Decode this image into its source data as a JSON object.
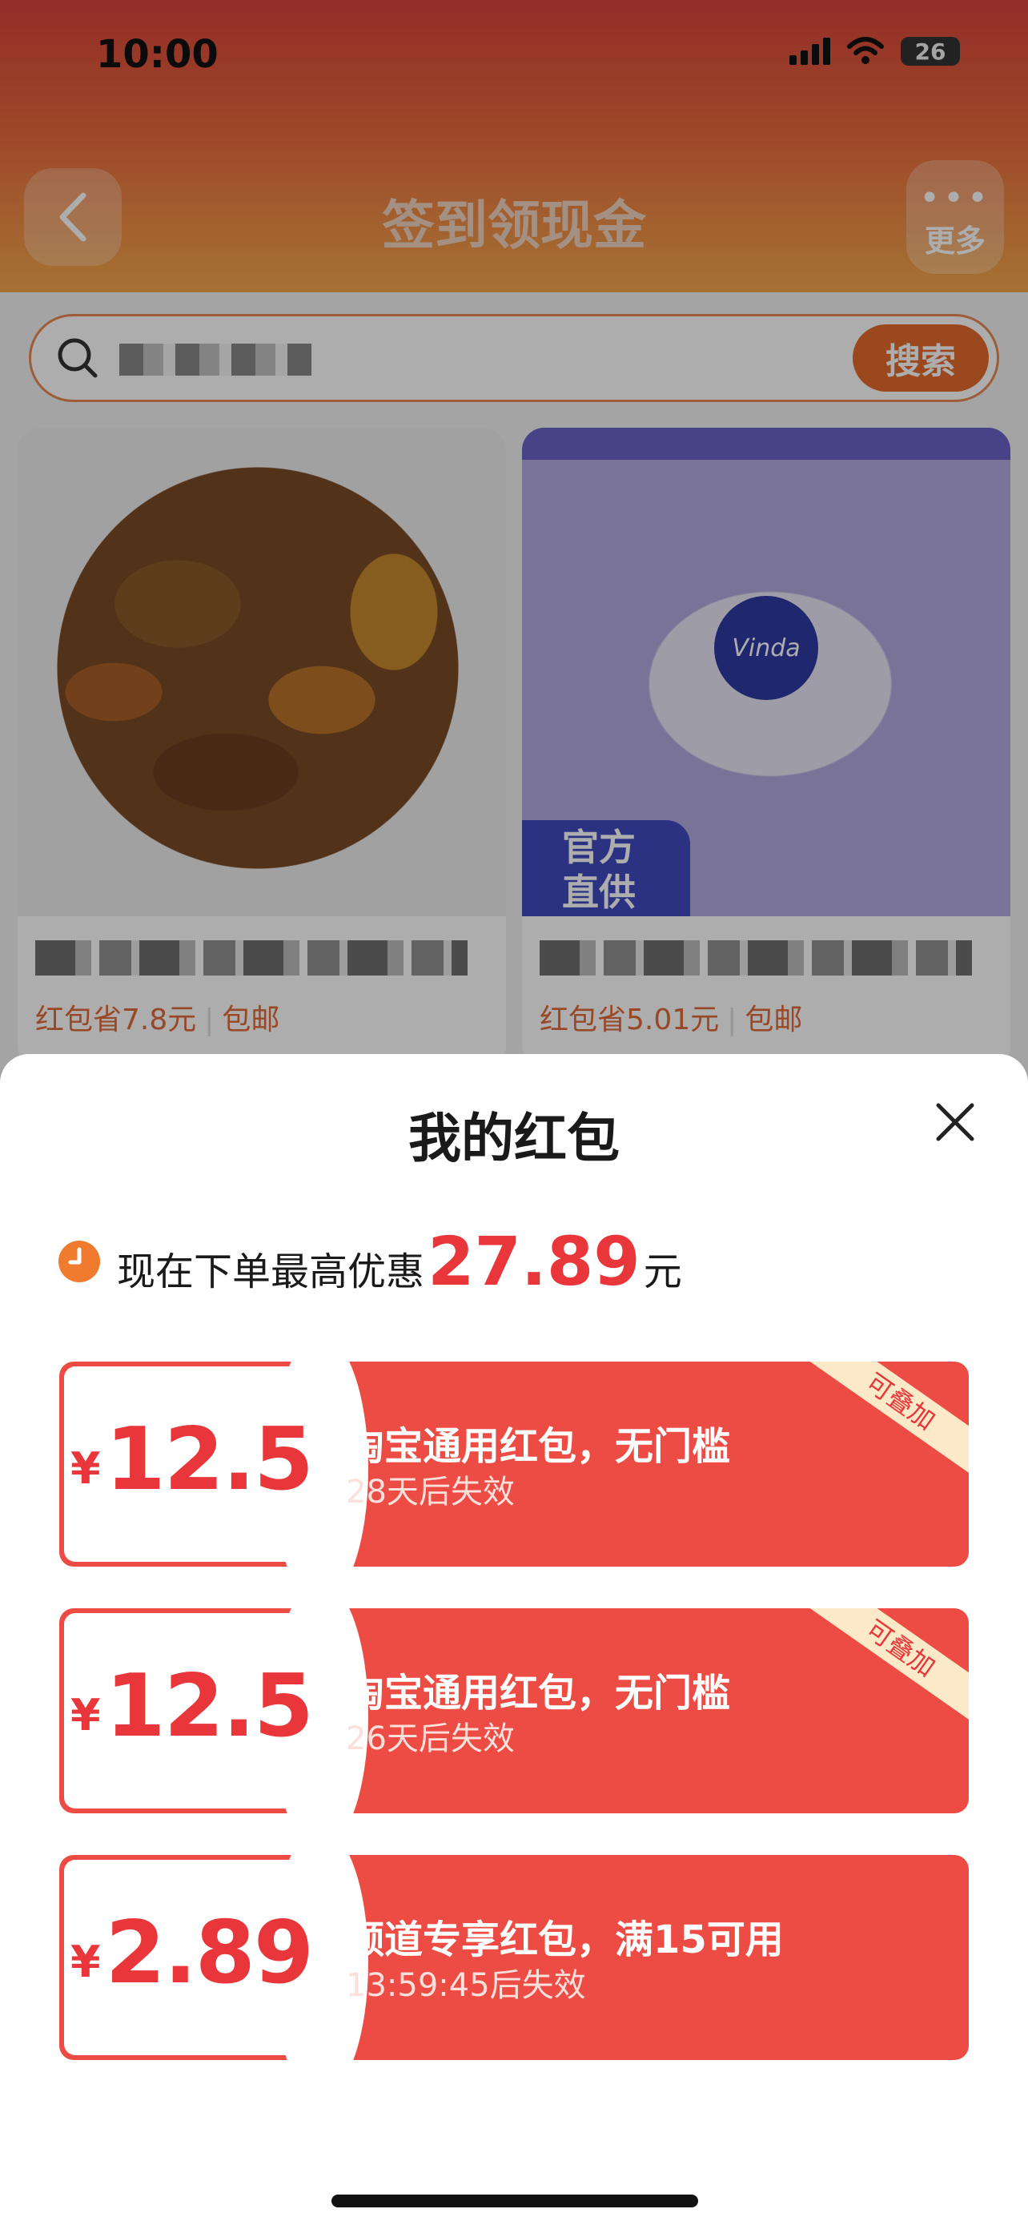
{
  "status_bar": {
    "time": "10:00",
    "battery": "26"
  },
  "nav": {
    "title": "签到领现金",
    "more_label": "更多"
  },
  "search": {
    "button_label": "搜索"
  },
  "products": [
    {
      "discount": "红包省7.8元",
      "shipping": "包邮"
    },
    {
      "discount": "红包省5.01元",
      "shipping": "包邮",
      "brand": "Vinda",
      "tag": "官方\n直供"
    }
  ],
  "sheet": {
    "title": "我的红包",
    "summary_prefix": "现在下单最高优惠",
    "summary_amount": "27.89",
    "summary_unit": "元"
  },
  "coupons": [
    {
      "currency": "¥",
      "amount": "12.5",
      "title": "淘宝通用红包，无门槛",
      "expiry": "28天后失效",
      "badge": "可叠加"
    },
    {
      "currency": "¥",
      "amount": "12.5",
      "title": "淘宝通用红包，无门槛",
      "expiry": "26天后失效",
      "badge": "可叠加"
    },
    {
      "currency": "¥",
      "amount": "2.89",
      "title": "频道专享红包，满15可用",
      "expiry": "13:59:45后失效"
    }
  ],
  "colors": {
    "accent_red": "#e8363a",
    "coupon_bg": "#ec4c44",
    "search_orange": "#e56a2d"
  }
}
